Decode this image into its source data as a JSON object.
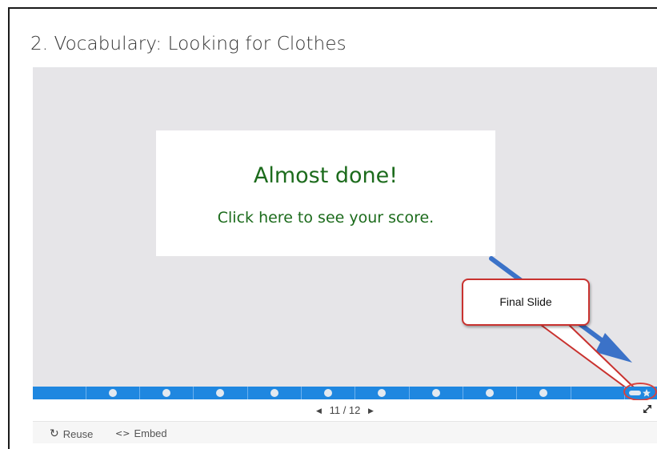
{
  "title": "2. Vocabulary: Looking for Clothes",
  "slide": {
    "heading": "Almost done!",
    "subtext": "Click here to see your score."
  },
  "annotation": {
    "callout_text": "Final Slide",
    "arrow_color": "#3b72c8",
    "callout_border_color": "#c9322f"
  },
  "progress": {
    "current": 11,
    "total": 12,
    "bar_color": "#1f87e0",
    "final_marker_icon": "star-icon"
  },
  "nav": {
    "counter": "11 / 12",
    "prev_icon": "◀",
    "next_icon": "▶",
    "fullscreen_icon": "expand-icon"
  },
  "footer": {
    "reuse_label": "Reuse",
    "reuse_icon": "↻",
    "embed_label": "Embed",
    "embed_icon": "<>"
  }
}
